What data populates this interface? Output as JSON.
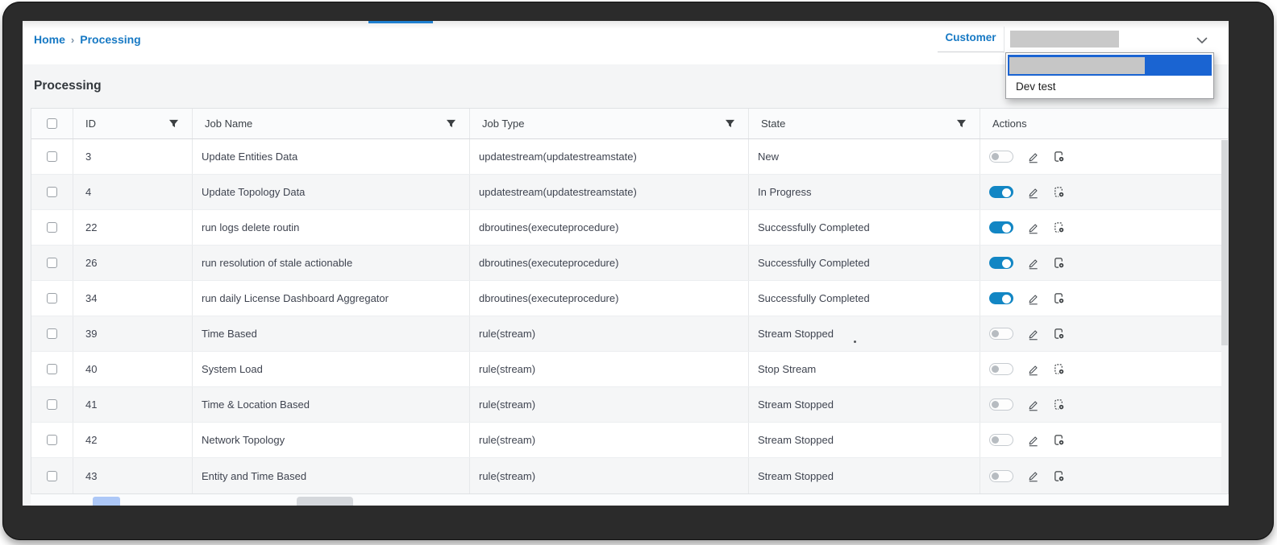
{
  "colors": {
    "brand_blue": "#1779c4",
    "toggle_on_blue": "#1286c4",
    "menu_highlight_blue": "#1a64d2",
    "tab_sliver_blue": "#1f7fd0",
    "redacted_gray": "#c9c9c9"
  },
  "breadcrumb": {
    "home": "Home",
    "separator": "›",
    "current": "Processing"
  },
  "page_title": "Processing",
  "customer": {
    "label": "Customer",
    "selected_value": "",
    "value_redacted": true,
    "dropdown_open": true,
    "options": [
      {
        "label": "",
        "redacted": true,
        "highlighted": true
      },
      {
        "label": "Dev test",
        "redacted": false,
        "highlighted": false
      }
    ]
  },
  "table": {
    "columns": [
      {
        "label": "",
        "has_filter": false
      },
      {
        "label": "ID",
        "has_filter": true
      },
      {
        "label": "Job Name",
        "has_filter": true
      },
      {
        "label": "Job Type",
        "has_filter": true
      },
      {
        "label": "State",
        "has_filter": true
      },
      {
        "label": "Actions",
        "has_filter": false
      }
    ],
    "rows": [
      {
        "id": "3",
        "name": "Update Entities Data",
        "type": "updatestream(updatestreamstate)",
        "state": "New",
        "toggle_on": false,
        "log_icon_variant": "solid"
      },
      {
        "id": "4",
        "name": "Update Topology Data",
        "type": "updatestream(updatestreamstate)",
        "state": "In Progress",
        "toggle_on": true,
        "log_icon_variant": "dashed"
      },
      {
        "id": "22",
        "name": "run logs delete routin",
        "type": "dbroutines(executeprocedure)",
        "state": "Successfully Completed",
        "toggle_on": true,
        "log_icon_variant": "dashed"
      },
      {
        "id": "26",
        "name": "run resolution of stale actionable",
        "type": "dbroutines(executeprocedure)",
        "state": "Successfully Completed",
        "toggle_on": true,
        "log_icon_variant": "solid"
      },
      {
        "id": "34",
        "name": "run daily License Dashboard Aggregator",
        "type": "dbroutines(executeprocedure)",
        "state": "Successfully Completed",
        "toggle_on": true,
        "log_icon_variant": "solid"
      },
      {
        "id": "39",
        "name": "Time Based",
        "type": "rule(stream)",
        "state": "Stream Stopped",
        "toggle_on": false,
        "log_icon_variant": "solid"
      },
      {
        "id": "40",
        "name": "System Load",
        "type": "rule(stream)",
        "state": "Stop Stream",
        "toggle_on": false,
        "log_icon_variant": "dashed"
      },
      {
        "id": "41",
        "name": "Time & Location Based",
        "type": "rule(stream)",
        "state": "Stream Stopped",
        "toggle_on": false,
        "log_icon_variant": "dashed"
      },
      {
        "id": "42",
        "name": "Network Topology",
        "type": "rule(stream)",
        "state": "Stream Stopped",
        "toggle_on": false,
        "log_icon_variant": "solid"
      },
      {
        "id": "43",
        "name": "Entity and Time Based",
        "type": "rule(stream)",
        "state": "Stream Stopped",
        "toggle_on": false,
        "log_icon_variant": "solid"
      }
    ]
  }
}
